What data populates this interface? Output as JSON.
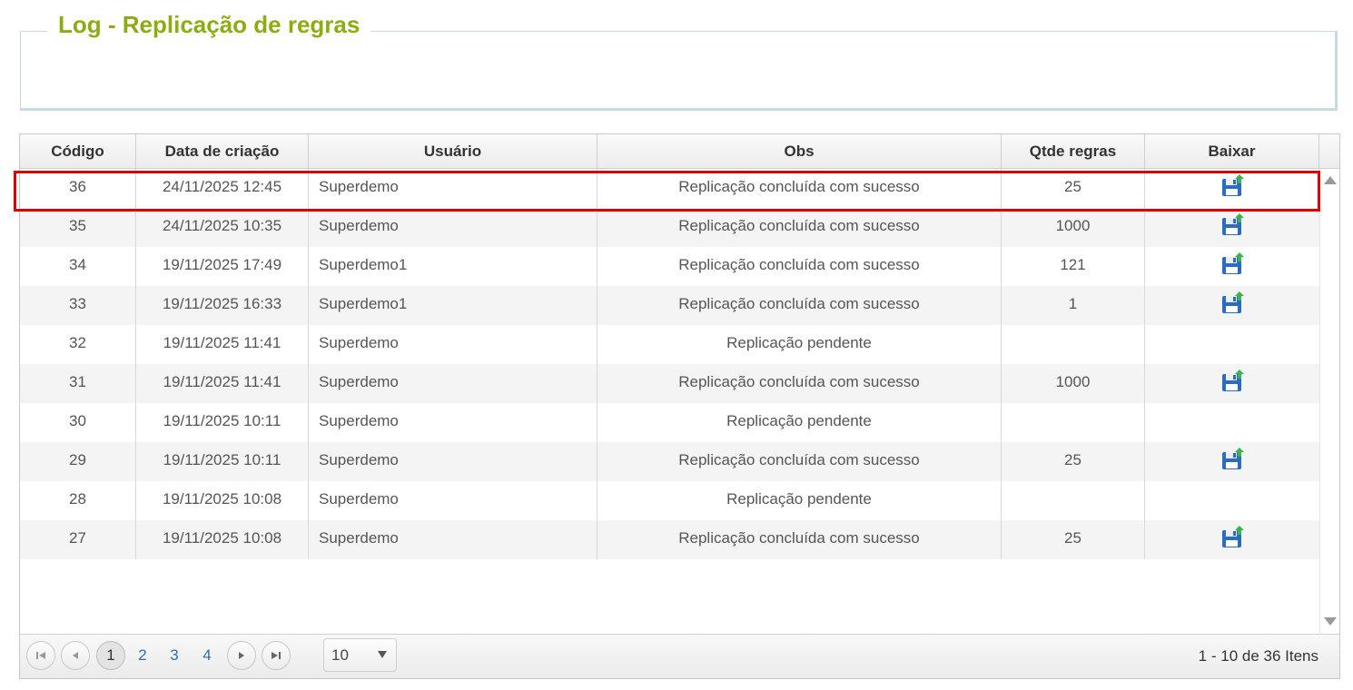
{
  "panel": {
    "title": "Log - Replicação de regras"
  },
  "grid": {
    "columns": [
      "Código",
      "Data de criação",
      "Usuário",
      "Obs",
      "Qtde regras",
      "Baixar"
    ],
    "rows": [
      {
        "codigo": "36",
        "data": "24/11/2025 12:45",
        "usuario": "Superdemo",
        "obs": "Replicação concluída com sucesso",
        "qtde": "25",
        "download": true
      },
      {
        "codigo": "35",
        "data": "24/11/2025 10:35",
        "usuario": "Superdemo",
        "obs": "Replicação concluída com sucesso",
        "qtde": "1000",
        "download": true
      },
      {
        "codigo": "34",
        "data": "19/11/2025 17:49",
        "usuario": "Superdemo1",
        "obs": "Replicação concluída com sucesso",
        "qtde": "121",
        "download": true
      },
      {
        "codigo": "33",
        "data": "19/11/2025 16:33",
        "usuario": "Superdemo1",
        "obs": "Replicação concluída com sucesso",
        "qtde": "1",
        "download": true
      },
      {
        "codigo": "32",
        "data": "19/11/2025 11:41",
        "usuario": "Superdemo",
        "obs": "Replicação pendente",
        "qtde": "",
        "download": false
      },
      {
        "codigo": "31",
        "data": "19/11/2025 11:41",
        "usuario": "Superdemo",
        "obs": "Replicação concluída com sucesso",
        "qtde": "1000",
        "download": true
      },
      {
        "codigo": "30",
        "data": "19/11/2025 10:11",
        "usuario": "Superdemo",
        "obs": "Replicação pendente",
        "qtde": "",
        "download": false
      },
      {
        "codigo": "29",
        "data": "19/11/2025 10:11",
        "usuario": "Superdemo",
        "obs": "Replicação concluída com sucesso",
        "qtde": "25",
        "download": true
      },
      {
        "codigo": "28",
        "data": "19/11/2025 10:08",
        "usuario": "Superdemo",
        "obs": "Replicação pendente",
        "qtde": "",
        "download": false
      },
      {
        "codigo": "27",
        "data": "19/11/2025 10:08",
        "usuario": "Superdemo",
        "obs": "Replicação concluída com sucesso",
        "qtde": "25",
        "download": true
      }
    ]
  },
  "pager": {
    "pages": [
      "1",
      "2",
      "3",
      "4"
    ],
    "current_page": "1",
    "page_size": "10",
    "info": "1 - 10 de 36 Itens"
  },
  "icons": {
    "download": "floppy-disk-icon",
    "first": "first-page-icon",
    "prev": "previous-page-icon",
    "next": "next-page-icon",
    "last": "last-page-icon"
  },
  "colors": {
    "title": "#8cac14",
    "highlight": "#e00000",
    "link": "#2e6fa7"
  }
}
